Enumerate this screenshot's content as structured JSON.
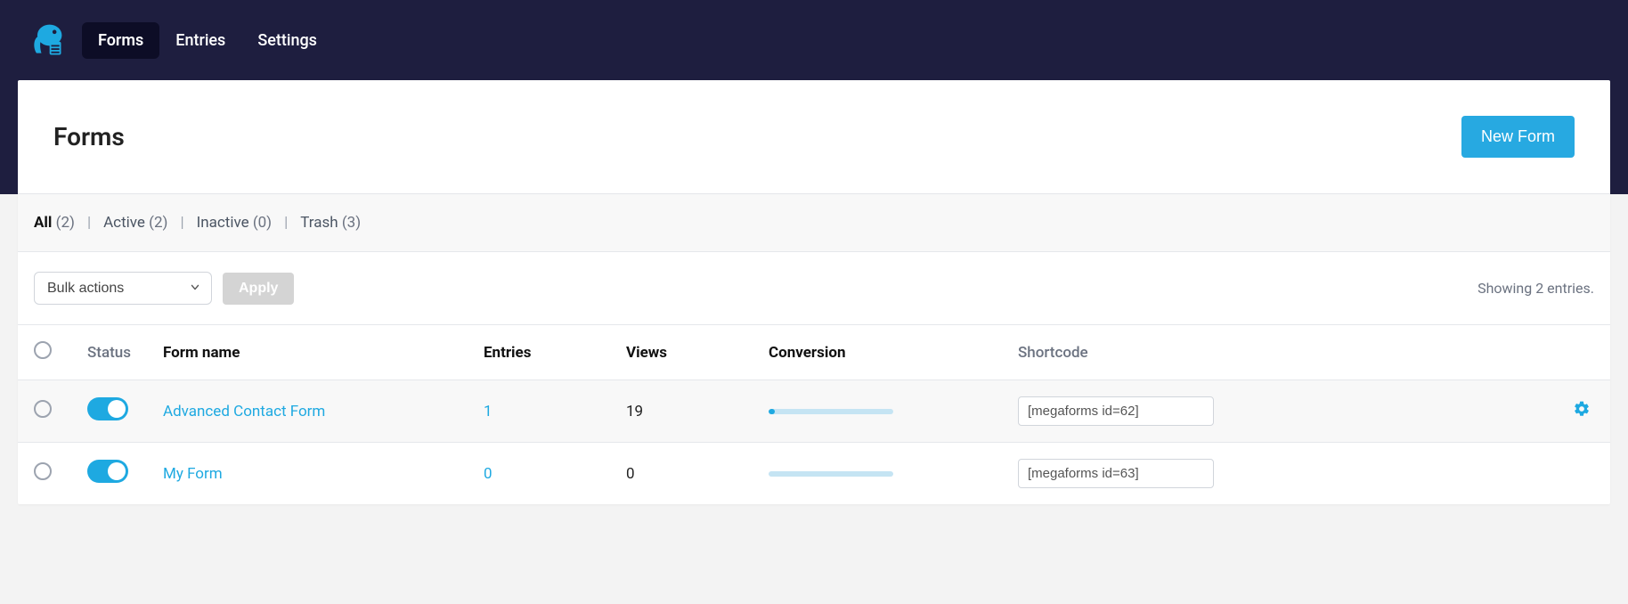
{
  "nav": {
    "tabs": [
      {
        "label": "Forms",
        "active": true
      },
      {
        "label": "Entries",
        "active": false
      },
      {
        "label": "Settings",
        "active": false
      }
    ]
  },
  "hero": {
    "title": "Forms",
    "new_button": "New Form"
  },
  "filters": [
    {
      "label": "All",
      "count": "(2)",
      "active": true
    },
    {
      "label": "Active",
      "count": "(2)",
      "active": false
    },
    {
      "label": "Inactive",
      "count": "(0)",
      "active": false
    },
    {
      "label": "Trash",
      "count": "(3)",
      "active": false
    }
  ],
  "bulk": {
    "select": "Bulk actions",
    "apply": "Apply",
    "showing": "Showing 2 entries."
  },
  "table": {
    "headers": {
      "status": "Status",
      "name": "Form name",
      "entries": "Entries",
      "views": "Views",
      "conversion": "Conversion",
      "shortcode": "Shortcode"
    },
    "rows": [
      {
        "active": true,
        "name": "Advanced Contact Form",
        "entries": "1",
        "views": "19",
        "conversion_pct": 5,
        "shortcode": "[megaforms id=62]",
        "show_gear": true
      },
      {
        "active": true,
        "name": "My Form",
        "entries": "0",
        "views": "0",
        "conversion_pct": 0,
        "shortcode": "[megaforms id=63]",
        "show_gear": false
      }
    ]
  }
}
